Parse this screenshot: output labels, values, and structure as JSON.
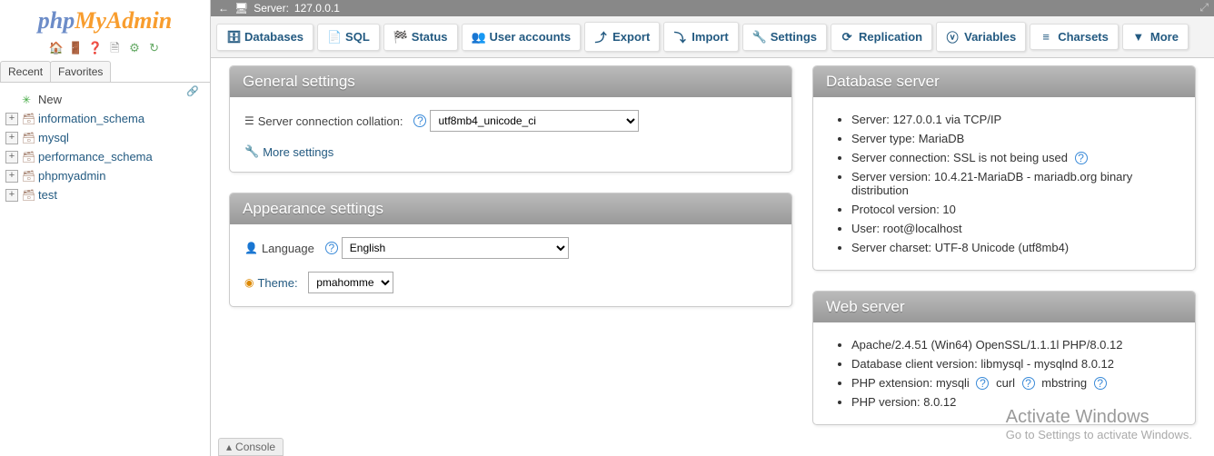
{
  "logo": {
    "part1": "php",
    "part2": "MyAdmin",
    "part3": ""
  },
  "sidebar": {
    "tabs": {
      "recent": "Recent",
      "favorites": "Favorites"
    },
    "items": [
      {
        "label": "New",
        "expandable": false,
        "new": true
      },
      {
        "label": "information_schema",
        "expandable": true
      },
      {
        "label": "mysql",
        "expandable": true
      },
      {
        "label": "performance_schema",
        "expandable": true
      },
      {
        "label": "phpmyadmin",
        "expandable": true
      },
      {
        "label": "test",
        "expandable": true
      }
    ]
  },
  "breadcrumb": {
    "server_label": "Server:",
    "server_value": "127.0.0.1"
  },
  "menu": [
    {
      "label": "Databases",
      "icon": "🗄"
    },
    {
      "label": "SQL",
      "icon": "📄"
    },
    {
      "label": "Status",
      "icon": "🏁"
    },
    {
      "label": "User accounts",
      "icon": "👥"
    },
    {
      "label": "Export",
      "icon": "⤴"
    },
    {
      "label": "Import",
      "icon": "⤵"
    },
    {
      "label": "Settings",
      "icon": "🔧"
    },
    {
      "label": "Replication",
      "icon": "⟳"
    },
    {
      "label": "Variables",
      "icon": "ⓥ"
    },
    {
      "label": "Charsets",
      "icon": "≡"
    },
    {
      "label": "More",
      "icon": "▼"
    }
  ],
  "general": {
    "title": "General settings",
    "collation_label": "Server connection collation:",
    "collation_value": "utf8mb4_unicode_ci",
    "more": "More settings"
  },
  "appearance": {
    "title": "Appearance settings",
    "language_label": "Language",
    "language_value": "English",
    "theme_label": "Theme:",
    "theme_value": "pmahomme"
  },
  "dbserver": {
    "title": "Database server",
    "items": [
      "Server: 127.0.0.1 via TCP/IP",
      "Server type: MariaDB",
      "Server connection: SSL is not being used",
      "Server version: 10.4.21-MariaDB - mariadb.org binary distribution",
      "Protocol version: 10",
      "User: root@localhost",
      "Server charset: UTF-8 Unicode (utf8mb4)"
    ]
  },
  "webserver": {
    "title": "Web server",
    "items": [
      "Apache/2.4.51 (Win64) OpenSSL/1.1.1l PHP/8.0.12",
      "Database client version: libmysql - mysqlnd 8.0.12"
    ],
    "php_ext_label": "PHP extension:",
    "php_exts": [
      "mysqli",
      "curl",
      "mbstring"
    ],
    "php_ver": "PHP version: 8.0.12"
  },
  "console": "Console",
  "watermark": {
    "l1": "Activate Windows",
    "l2": "Go to Settings to activate Windows."
  }
}
